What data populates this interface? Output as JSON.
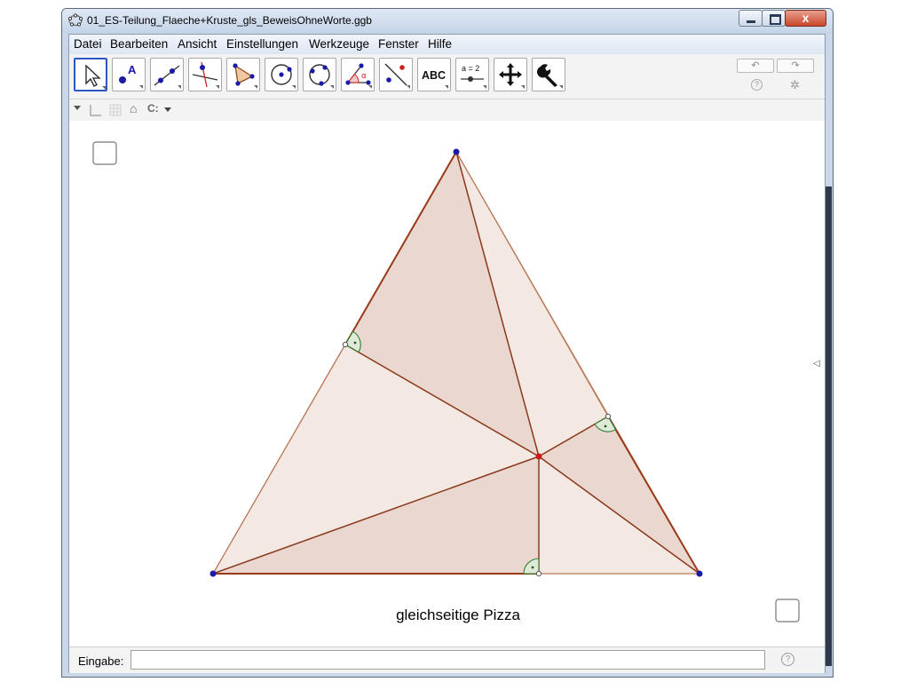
{
  "window": {
    "title": "01_ES-Teilung_Flaeche+Kruste_gls_BeweisOhneWorte.ggb",
    "close_glyph": "x"
  },
  "menu": [
    "Datei",
    "Bearbeiten",
    "Ansicht",
    "Einstellungen",
    "Werkzeuge",
    "Fenster",
    "Hilfe"
  ],
  "toolbar": {
    "tools": [
      {
        "name": "move-tool-icon",
        "active": true
      },
      {
        "name": "point-tool-icon",
        "label": "A"
      },
      {
        "name": "line-tool-icon"
      },
      {
        "name": "perpendicular-line-tool-icon"
      },
      {
        "name": "polygon-tool-icon"
      },
      {
        "name": "circle-tool-icon"
      },
      {
        "name": "circle-three-points-tool-icon"
      },
      {
        "name": "angle-tool-icon",
        "label": "α"
      },
      {
        "name": "reflect-tool-icon"
      },
      {
        "name": "text-tool-icon",
        "label": "ABC"
      },
      {
        "name": "slider-tool-icon",
        "label": "a = 2"
      },
      {
        "name": "move-graphics-view-tool-icon"
      },
      {
        "name": "wrench-tool-icon"
      }
    ],
    "undo_glyph": "↶",
    "redo_glyph": "↷",
    "help_glyph": "?",
    "settings_glyph": "✲"
  },
  "stylebar": {
    "home_glyph": "⌂",
    "style_glyph": "C:"
  },
  "graphics": {
    "caption": "gleichseitige Pizza",
    "colors": {
      "fill_light": "#f4e8e3",
      "fill_dark": "#ead8d0",
      "edge": "#9b4a22",
      "vertex": "#1a1aa8",
      "center": "#cc1a1a",
      "right_angle": "#2e7d32"
    }
  },
  "inputbar": {
    "label": "Eingabe:",
    "value": "",
    "help_glyph": "?"
  }
}
